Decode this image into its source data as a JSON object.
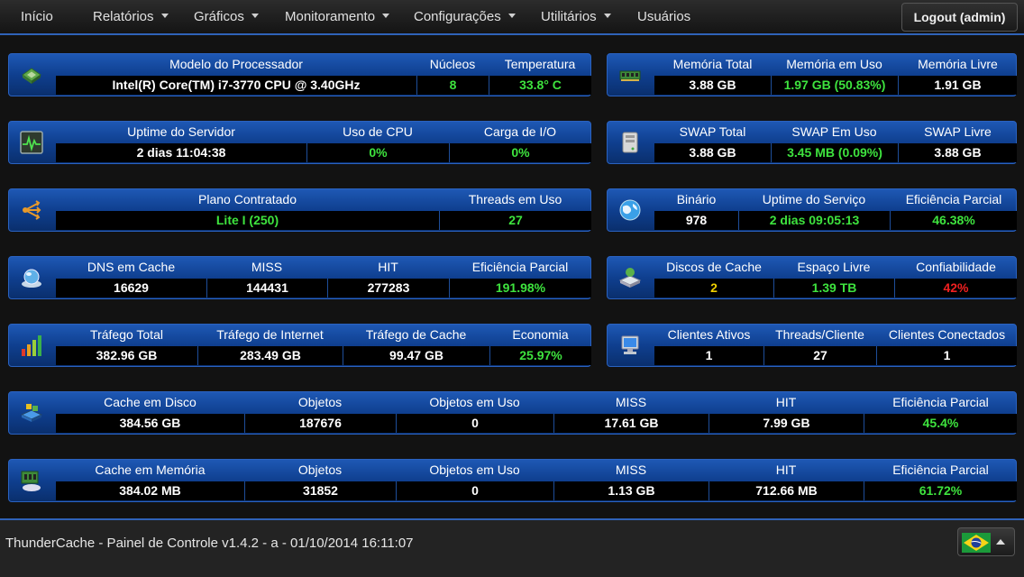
{
  "nav": {
    "items": [
      {
        "label": "Início",
        "dropdown": false
      },
      {
        "label": "Relatórios",
        "dropdown": true
      },
      {
        "label": "Gráficos",
        "dropdown": true
      },
      {
        "label": "Monitoramento",
        "dropdown": true
      },
      {
        "label": "Configurações",
        "dropdown": true
      },
      {
        "label": "Utilitários",
        "dropdown": true
      },
      {
        "label": "Usuários",
        "dropdown": false
      }
    ],
    "logout_label": "Logout (admin)"
  },
  "panels": [
    {
      "id": "processor",
      "icon": "cpu-chip-icon",
      "headers": [
        "Modelo do Processador",
        "Núcleos",
        "Temperatura"
      ],
      "values": [
        {
          "v": "Intel(R) Core(TM) i7-3770 CPU @ 3.40GHz",
          "c": "white"
        },
        {
          "v": "8",
          "c": "green"
        },
        {
          "v": "33.8° C",
          "c": "green"
        }
      ]
    },
    {
      "id": "memory",
      "icon": "memory-module-icon",
      "headers": [
        "Memória Total",
        "Memória em Uso",
        "Memória Livre"
      ],
      "values": [
        {
          "v": "3.88 GB",
          "c": "white"
        },
        {
          "v": "1.97 GB (50.83%)",
          "c": "green"
        },
        {
          "v": "1.91 GB",
          "c": "white"
        }
      ]
    },
    {
      "id": "uptime",
      "icon": "activity-monitor-icon",
      "headers": [
        "Uptime do Servidor",
        "Uso de CPU",
        "Carga de I/O"
      ],
      "values": [
        {
          "v": "2 dias 11:04:38",
          "c": "white"
        },
        {
          "v": "0%",
          "c": "green"
        },
        {
          "v": "0%",
          "c": "green"
        }
      ]
    },
    {
      "id": "swap",
      "icon": "hard-drive-icon",
      "headers": [
        "SWAP Total",
        "SWAP Em Uso",
        "SWAP Livre"
      ],
      "values": [
        {
          "v": "3.88 GB",
          "c": "white"
        },
        {
          "v": "3.45 MB (0.09%)",
          "c": "green"
        },
        {
          "v": "3.88 GB",
          "c": "white"
        }
      ]
    },
    {
      "id": "plan",
      "icon": "network-share-icon",
      "headers": [
        "Plano Contratado",
        "Threads em Uso"
      ],
      "values": [
        {
          "v": "Lite I (250)",
          "c": "green"
        },
        {
          "v": "27",
          "c": "green"
        }
      ]
    },
    {
      "id": "binary",
      "icon": "globe-icon",
      "headers": [
        "Binário",
        "Uptime do Serviço",
        "Eficiência Parcial"
      ],
      "values": [
        {
          "v": "978",
          "c": "white"
        },
        {
          "v": "2 dias 09:05:13",
          "c": "green"
        },
        {
          "v": "46.38%",
          "c": "green"
        }
      ]
    },
    {
      "id": "dns",
      "icon": "dns-cache-icon",
      "headers": [
        "DNS em Cache",
        "MISS",
        "HIT",
        "Eficiência Parcial"
      ],
      "values": [
        {
          "v": "16629",
          "c": "white"
        },
        {
          "v": "144431",
          "c": "white"
        },
        {
          "v": "277283",
          "c": "white"
        },
        {
          "v": "191.98%",
          "c": "green"
        }
      ]
    },
    {
      "id": "disks",
      "icon": "disk-drive-icon",
      "headers": [
        "Discos de Cache",
        "Espaço Livre",
        "Confiabilidade"
      ],
      "values": [
        {
          "v": "2",
          "c": "yellow"
        },
        {
          "v": "1.39 TB",
          "c": "green"
        },
        {
          "v": "42%",
          "c": "red"
        }
      ]
    },
    {
      "id": "traffic",
      "icon": "bar-chart-icon",
      "headers": [
        "Tráfego Total",
        "Tráfego de Internet",
        "Tráfego de Cache",
        "Economia"
      ],
      "values": [
        {
          "v": "382.96 GB",
          "c": "white"
        },
        {
          "v": "283.49 GB",
          "c": "white"
        },
        {
          "v": "99.47 GB",
          "c": "white"
        },
        {
          "v": "25.97%",
          "c": "green"
        }
      ]
    },
    {
      "id": "clients",
      "icon": "client-computer-icon",
      "headers": [
        "Clientes Ativos",
        "Threads/Cliente",
        "Clientes Conectados"
      ],
      "values": [
        {
          "v": "1",
          "c": "white"
        },
        {
          "v": "27",
          "c": "white"
        },
        {
          "v": "1",
          "c": "white"
        }
      ]
    },
    {
      "id": "diskcache",
      "icon": "disk-cache-icon",
      "headers": [
        "Cache em Disco",
        "Objetos",
        "Objetos em Uso",
        "MISS",
        "HIT",
        "Eficiência Parcial"
      ],
      "values": [
        {
          "v": "384.56 GB",
          "c": "white"
        },
        {
          "v": "187676",
          "c": "white"
        },
        {
          "v": "0",
          "c": "white"
        },
        {
          "v": "17.61 GB",
          "c": "white"
        },
        {
          "v": "7.99 GB",
          "c": "white"
        },
        {
          "v": "45.4%",
          "c": "green"
        }
      ]
    },
    {
      "id": "memcache",
      "icon": "memory-cache-icon",
      "headers": [
        "Cache em Memória",
        "Objetos",
        "Objetos em Uso",
        "MISS",
        "HIT",
        "Eficiência Parcial"
      ],
      "values": [
        {
          "v": "384.02 MB",
          "c": "white"
        },
        {
          "v": "31852",
          "c": "white"
        },
        {
          "v": "0",
          "c": "white"
        },
        {
          "v": "1.13 GB",
          "c": "white"
        },
        {
          "v": "712.66 MB",
          "c": "white"
        },
        {
          "v": "61.72%",
          "c": "green"
        }
      ]
    }
  ],
  "footer": {
    "text": "ThunderCache - Painel de Controle v1.4.2 - a - 01/10/2014 16:11:07",
    "language_flag": "brazil-flag-icon"
  },
  "colors": {
    "accent": "#2f62b8",
    "green": "#3ee33e",
    "yellow": "#f0d000",
    "red": "#f02020"
  }
}
